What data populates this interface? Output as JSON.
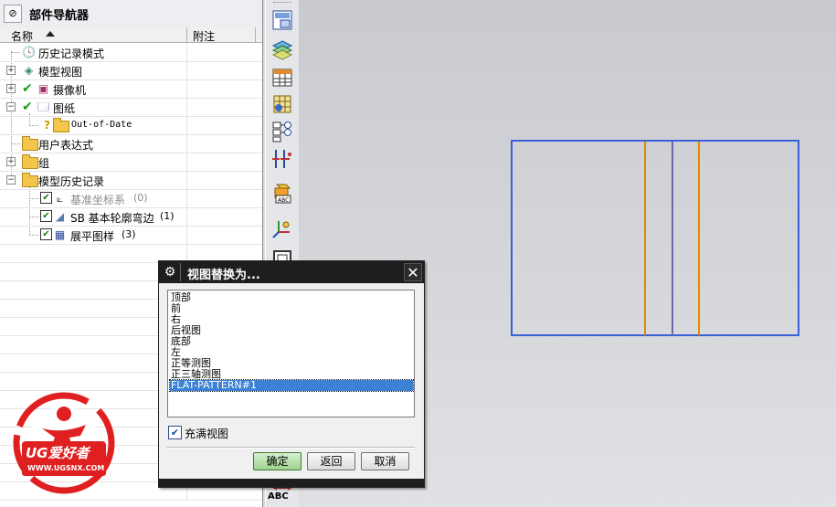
{
  "navigator": {
    "title": "部件导航器",
    "columns": {
      "name": "名称",
      "note": "附注"
    },
    "rows": [
      {
        "label": "历史记录模式",
        "expander": "",
        "checked": false
      },
      {
        "label": "模型视图",
        "expander": "+",
        "checked": false
      },
      {
        "label": "摄像机",
        "expander": "+",
        "checked": true
      },
      {
        "label": "图纸",
        "expander": "−",
        "checked": true
      },
      {
        "label": "Out-of-Date",
        "expander": "",
        "checked": false
      },
      {
        "label": "用户表达式",
        "expander": "",
        "checked": false
      },
      {
        "label": "组",
        "expander": "+",
        "checked": false
      },
      {
        "label": "模型历史记录",
        "expander": "−",
        "checked": false
      },
      {
        "label": "基准坐标系",
        "suffix": "(0)",
        "expander": "",
        "checked": true
      },
      {
        "label": "SB 基本轮廓弯边",
        "suffix": "(1)",
        "expander": "",
        "checked": true
      },
      {
        "label": "展平图样",
        "suffix": "(3)",
        "expander": "",
        "checked": true
      }
    ]
  },
  "toolbar": {
    "icons": [
      "view-layout-icon",
      "layers-icon",
      "table-icon",
      "display-grid-icon",
      "hierarchy-icon",
      "dimension-icon",
      "cube-abc-icon",
      "csys-icon",
      "frame-icon"
    ],
    "bottom_label": "ABC"
  },
  "dialog": {
    "title": "视图替换为...",
    "views": [
      "顶部",
      "前",
      "右",
      "后视图",
      "底部",
      "左",
      "正等测图",
      "正三轴测图",
      "FLAT-PATTERN#1"
    ],
    "selected_index": 8,
    "fit_view_label": "充满视图",
    "fit_view_checked": true,
    "buttons": {
      "ok": "确定",
      "back": "返回",
      "cancel": "取消"
    }
  },
  "graphics": {
    "outline_color": "#3a5fd6",
    "bend_line_colors": [
      "#e08a00",
      "#6a6aa8",
      "#e08a00"
    ]
  },
  "watermark": {
    "brand": "UG爱好者",
    "url": "WWW.UGSNX.COM"
  }
}
